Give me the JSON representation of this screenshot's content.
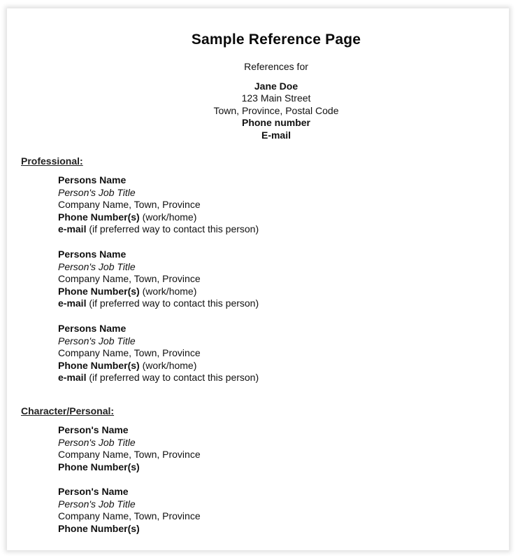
{
  "document": {
    "title": "Sample Reference Page",
    "intro": "References for",
    "applicant": {
      "name": "Jane Doe",
      "street": "123 Main Street",
      "city_line": "Town, Province, Postal Code",
      "phone": "Phone number",
      "email": "E-mail"
    },
    "sections": [
      {
        "heading": "Professional:",
        "references": [
          {
            "name": "Persons Name",
            "job_title": "Person's Job Title",
            "company": "Company Name, Town, Province",
            "phone_label": "Phone Number(s)",
            "phone_note": " (work/home)",
            "email_label": "e-mail",
            "email_note": " (if preferred way to contact this person)"
          },
          {
            "name": "Persons Name",
            "job_title": "Person's Job Title",
            "company": "Company Name, Town, Province",
            "phone_label": "Phone Number(s)",
            "phone_note": " (work/home)",
            "email_label": "e-mail",
            "email_note": " (if preferred way to contact this person)"
          },
          {
            "name": "Persons Name",
            "job_title": "Person's Job Title",
            "company": "Company Name, Town, Province",
            "phone_label": "Phone Number(s)",
            "phone_note": " (work/home)",
            "email_label": "e-mail",
            "email_note": " (if preferred way to contact this person)"
          }
        ]
      },
      {
        "heading": "Character/Personal:",
        "references": [
          {
            "name": "Person's Name",
            "job_title": "Person's Job Title",
            "company": "Company Name, Town, Province",
            "phone_label": "Phone Number(s)"
          },
          {
            "name": "Person's Name",
            "job_title": "Person's Job Title",
            "company": "Company Name, Town, Province",
            "phone_label": "Phone Number(s)"
          }
        ]
      }
    ]
  }
}
